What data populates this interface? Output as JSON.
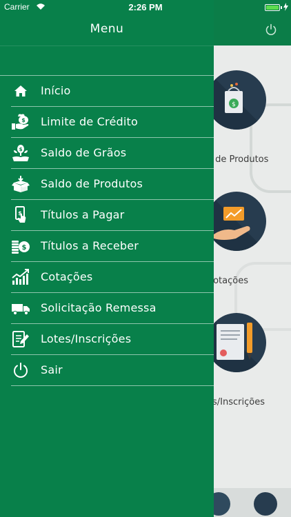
{
  "status_bar": {
    "carrier": "Carrier",
    "time": "2:26 PM"
  },
  "drawer": {
    "title": "Menu",
    "items": [
      {
        "label": "Início",
        "icon": "home-icon"
      },
      {
        "label": "Limite de Crédito",
        "icon": "hand-money-icon"
      },
      {
        "label": "Saldo de Grãos",
        "icon": "plant-icon"
      },
      {
        "label": "Saldo de Produtos",
        "icon": "box-icon"
      },
      {
        "label": "Títulos a Pagar",
        "icon": "pay-icon"
      },
      {
        "label": "Títulos a Receber",
        "icon": "coins-icon"
      },
      {
        "label": "Cotações",
        "icon": "chart-icon"
      },
      {
        "label": "Solicitação Remessa",
        "icon": "truck-icon"
      },
      {
        "label": "Lotes/Inscrições",
        "icon": "document-edit-icon"
      },
      {
        "label": "Sair",
        "icon": "power-icon"
      }
    ]
  },
  "background": {
    "labels": [
      "o de Produtos",
      "Cotações",
      "es/Inscrições"
    ]
  },
  "colors": {
    "drawer": "#08804a",
    "header": "#0b7d48",
    "card": "#273c4f"
  }
}
